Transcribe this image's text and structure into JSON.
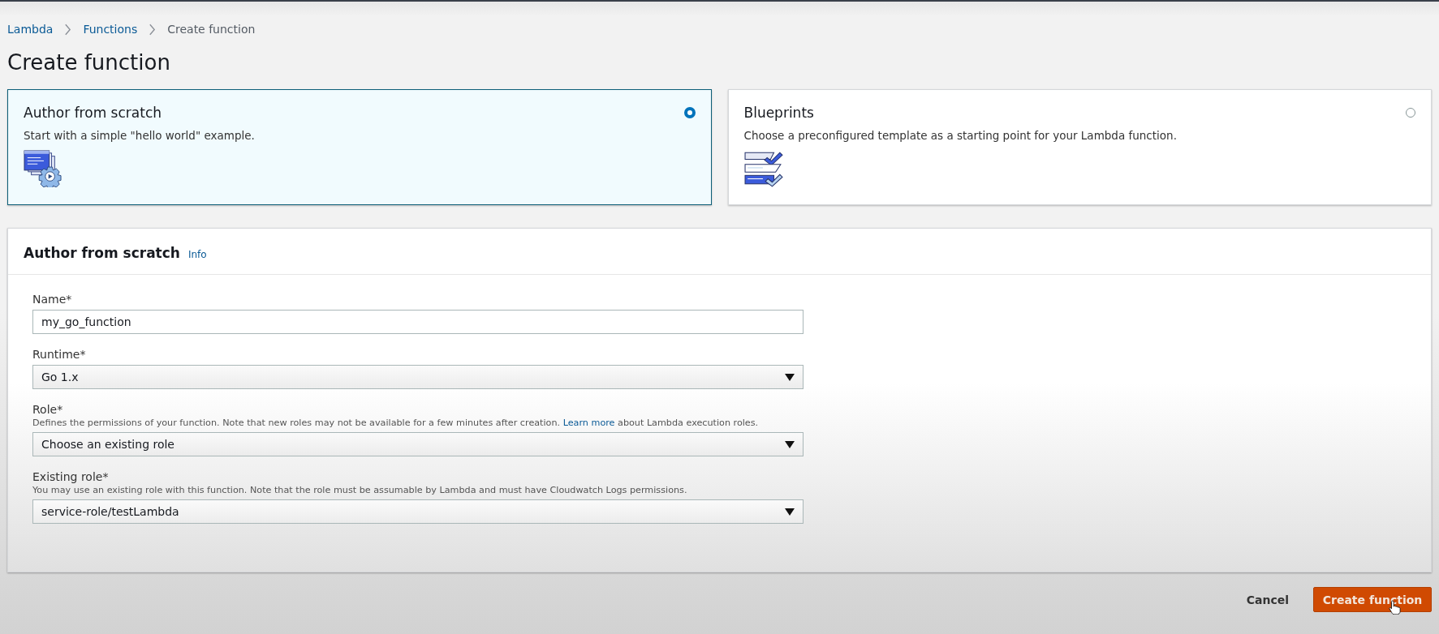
{
  "breadcrumbs": [
    {
      "label": "Lambda",
      "kind": "link"
    },
    {
      "label": "Functions",
      "kind": "link"
    },
    {
      "label": "Create function",
      "kind": "current"
    }
  ],
  "page_title": "Create function",
  "options": [
    {
      "title": "Author from scratch",
      "description": "Start with a simple \"hello world\" example.",
      "kind": "scratch",
      "selected": true
    },
    {
      "title": "Blueprints",
      "description": "Choose a preconfigured template as a starting point for your Lambda function.",
      "kind": "blueprints",
      "selected": false
    }
  ],
  "form": {
    "title": "Author from scratch",
    "info_link": "Info",
    "fields": [
      {
        "label": "Name*",
        "kind": "text",
        "value": "my_go_function"
      },
      {
        "label": "Runtime*",
        "kind": "select",
        "value": "Go 1.x"
      },
      {
        "label": "Role*",
        "kind": "select",
        "value": "Choose an existing role",
        "description": "Defines the permissions of your function. Note that new roles may not be available for a few minutes after creation.",
        "description_link": "Learn more",
        "description_after": "about Lambda execution roles."
      },
      {
        "label": "Existing role*",
        "kind": "select",
        "value": "service-role/testLambda",
        "description": "You may use an existing role with this function. Note that the role must be assumable by Lambda and must have Cloudwatch Logs permissions."
      }
    ]
  },
  "buttons": [
    {
      "label": "Cancel",
      "kind": "link"
    },
    {
      "label": "Create function",
      "kind": "primary"
    }
  ]
}
